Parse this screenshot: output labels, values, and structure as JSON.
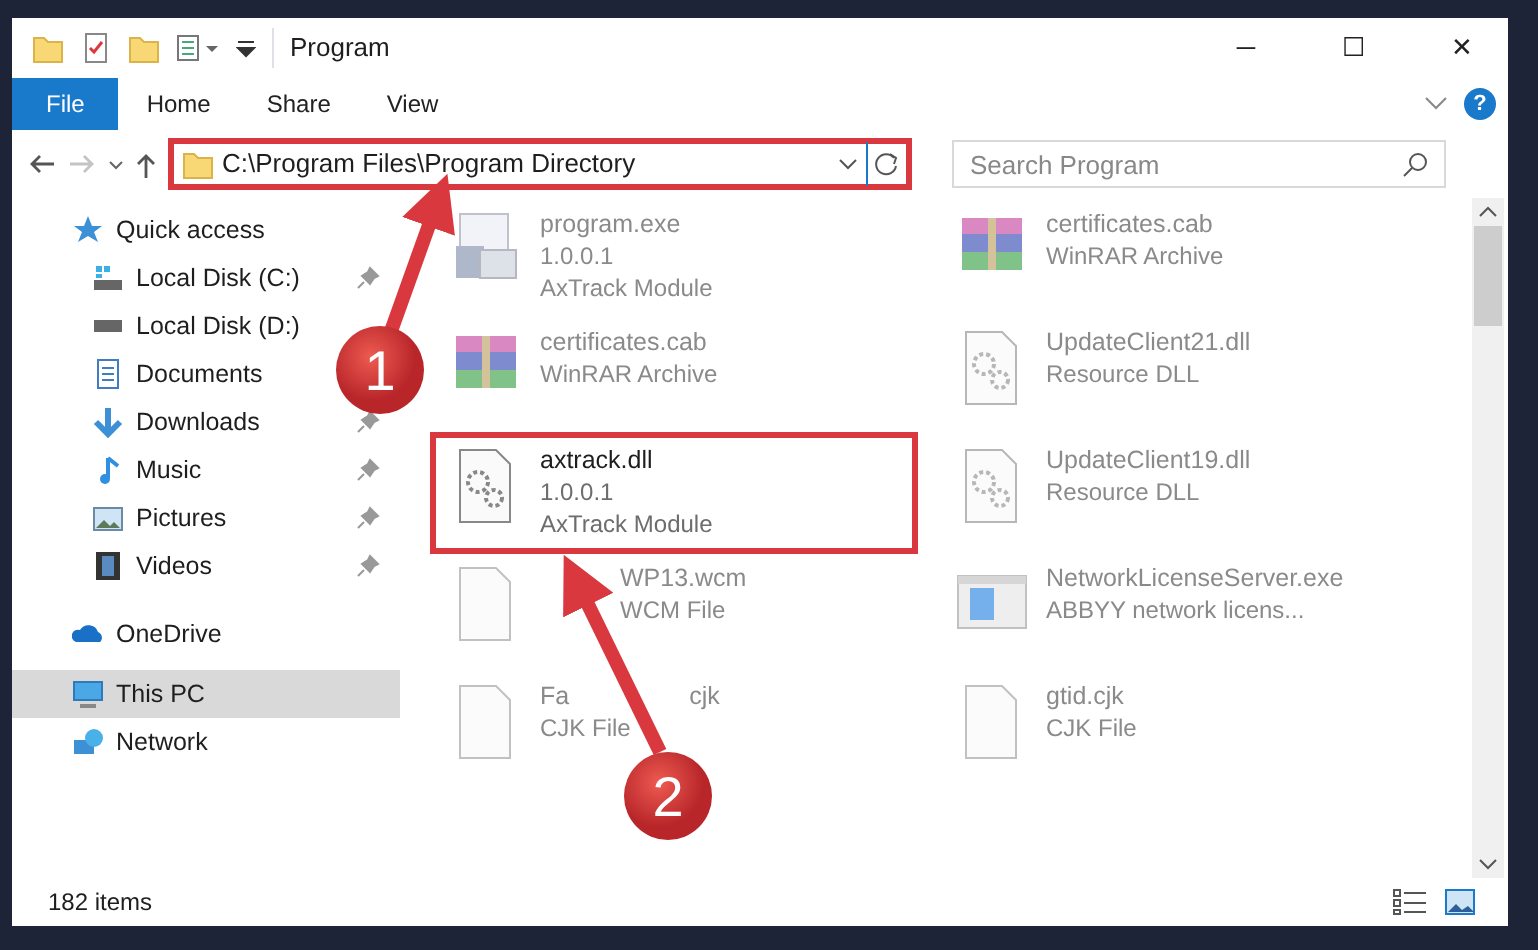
{
  "window": {
    "title": "Program",
    "controls": [
      "─",
      "☐",
      "✕"
    ]
  },
  "ribbon": {
    "tabs": [
      {
        "label": "File",
        "kind": "file"
      },
      {
        "label": "Home",
        "kind": "tab"
      },
      {
        "label": "Share",
        "kind": "tab"
      },
      {
        "label": "View",
        "kind": "tab"
      }
    ],
    "help": "?"
  },
  "address_bar": {
    "path": "C:\\Program Files\\Program Directory",
    "highlighted": true,
    "forward_disabled": true
  },
  "search": {
    "placeholder": "Search Program"
  },
  "sidebar": {
    "items": [
      {
        "label": "Quick access",
        "kind": "star",
        "selected": false,
        "children": [
          {
            "label": "Local Disk (C:)",
            "kind": "windrive",
            "pinned": true
          },
          {
            "label": "Local Disk (D:)",
            "kind": "drive",
            "pinned": false
          },
          {
            "label": "Documents",
            "kind": "docs",
            "pinned": false
          },
          {
            "label": "Downloads",
            "kind": "download",
            "pinned": true
          },
          {
            "label": "Music",
            "kind": "music",
            "pinned": true
          },
          {
            "label": "Pictures",
            "kind": "pictures",
            "pinned": true
          },
          {
            "label": "Videos",
            "kind": "videos",
            "pinned": true
          }
        ]
      },
      {
        "label": "OneDrive",
        "kind": "cloud",
        "selected": false
      },
      {
        "label": "This PC",
        "kind": "pc",
        "selected": true
      },
      {
        "label": "Network",
        "kind": "network",
        "selected": false
      }
    ]
  },
  "files": [
    {
      "name": "program.exe",
      "details": [
        "1.0.0.1",
        "AxTrack Module"
      ],
      "kind": "exe",
      "faded": true,
      "highlighted": false
    },
    {
      "name": "certificates.cab",
      "details": [
        "WinRAR Archive"
      ],
      "kind": "archive",
      "faded": true,
      "highlighted": false
    },
    {
      "name": "certificates.cab",
      "details": [
        "WinRAR Archive"
      ],
      "kind": "archive",
      "faded": true,
      "highlighted": false
    },
    {
      "name": "UpdateClient21.dll",
      "details": [
        "Resource DLL"
      ],
      "kind": "dll",
      "faded": true,
      "highlighted": false
    },
    {
      "name": "axtrack.dll",
      "details": [
        "1.0.0.1",
        "AxTrack Module"
      ],
      "kind": "dll",
      "faded": false,
      "highlighted": true
    },
    {
      "name": "UpdateClient19.dll",
      "details": [
        "Resource DLL"
      ],
      "kind": "dll",
      "faded": true,
      "highlighted": false
    },
    {
      "name": "WP13.wcm",
      "details": [
        "WCM File"
      ],
      "kind": "blank",
      "faded": true,
      "highlighted": false,
      "covered_start": true
    },
    {
      "name": "NetworkLicenseServer.exe",
      "details": [
        "ABBYY network licens..."
      ],
      "kind": "app",
      "faded": true,
      "highlighted": false
    },
    {
      "name": "Fa",
      "name_tail": "cjk",
      "details": [
        "CJK File"
      ],
      "kind": "blank",
      "faded": true,
      "highlighted": false
    },
    {
      "name": "gtid.cjk",
      "details": [
        "CJK File"
      ],
      "kind": "blank",
      "faded": true,
      "highlighted": false
    }
  ],
  "status_bar": {
    "count": "182 items"
  },
  "annotations": [
    {
      "label": "1"
    },
    {
      "label": "2"
    }
  ]
}
